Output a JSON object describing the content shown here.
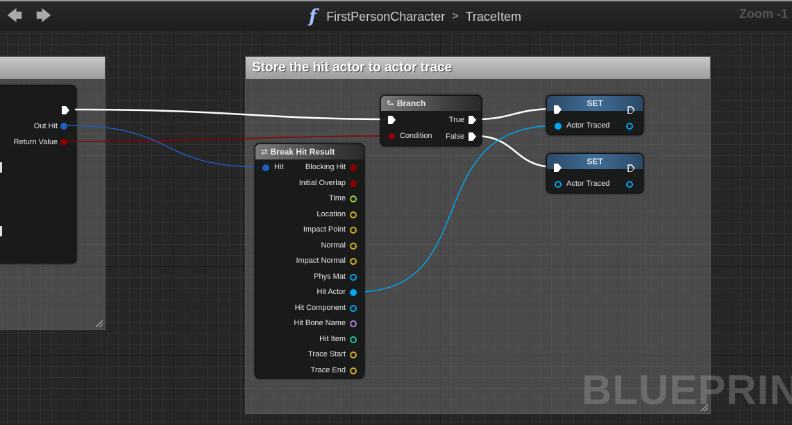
{
  "topbar": {
    "breadcrumb": [
      "FirstPersonCharacter",
      "TraceItem"
    ],
    "separator": ">",
    "zoom": "Zoom -1"
  },
  "comment_right": {
    "title": "Store the hit actor to actor trace"
  },
  "left_node": {
    "pins": [
      "Out Hit",
      "Return Value"
    ]
  },
  "branch": {
    "title": "Branch",
    "inputs": [
      "Condition"
    ],
    "outputs": [
      "True",
      "False"
    ]
  },
  "break_hit": {
    "title": "Break Hit Result",
    "input": "Hit",
    "outputs": [
      "Blocking Hit",
      "Initial Overlap",
      "Time",
      "Location",
      "Impact Point",
      "Normal",
      "Impact Normal",
      "Phys Mat",
      "Hit Actor",
      "Hit Component",
      "Hit Bone Name",
      "Hit Item",
      "Trace Start",
      "Trace End"
    ]
  },
  "set_nodes": [
    {
      "title": "SET",
      "pin": "Actor Traced"
    },
    {
      "title": "SET",
      "pin": "Actor Traced"
    }
  ],
  "watermark": "BLUEPRINT",
  "colors": {
    "exec": "#ffffff",
    "bool": "#8c0000",
    "struct": "#1f5fbf",
    "object": "#00a8f0",
    "float": "#9bd53a",
    "vector": "#d4b021",
    "name": "#b07fe0",
    "int": "#1fc7a0"
  }
}
